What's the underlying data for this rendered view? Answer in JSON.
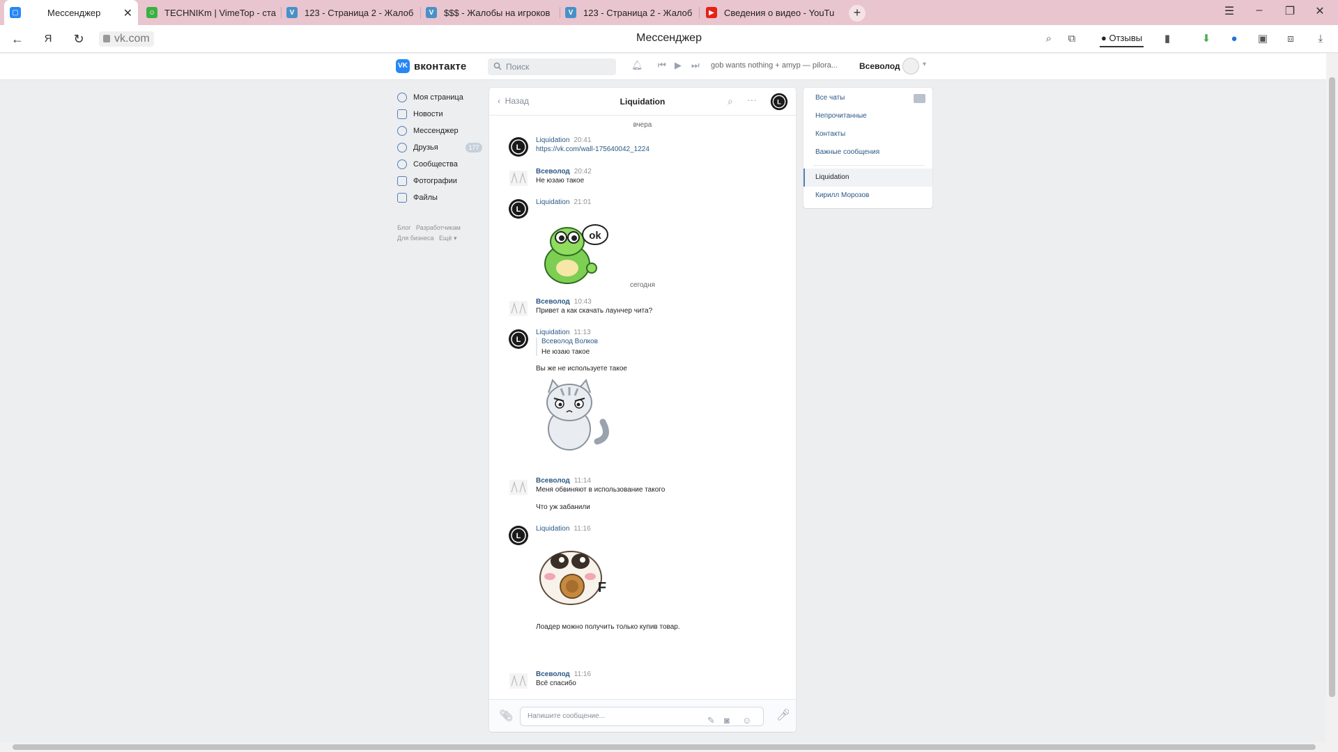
{
  "browser": {
    "tabs": [
      {
        "title": "Мессенджер",
        "active": true,
        "icon": "vk-messenger-icon"
      },
      {
        "title": "TECHNIKm | VimeTop - ста",
        "active": false,
        "icon": "vimetop-icon"
      },
      {
        "title": "123 - Страница 2 - Жалоб",
        "active": false,
        "icon": "forum-icon"
      },
      {
        "title": "$$$ - Жалобы на игроков",
        "active": false,
        "icon": "forum-icon"
      },
      {
        "title": "123 - Страница 2 - Жалоб",
        "active": false,
        "icon": "forum-icon"
      },
      {
        "title": "Сведения о видео - YouTu",
        "active": false,
        "icon": "youtube-icon"
      }
    ],
    "url": "vk.com",
    "page_title": "Мессенджер",
    "reviews_label": "Отзывы",
    "colors": {
      "tabbar": "#e9c5cf"
    }
  },
  "vk": {
    "logo_text": "вконтакте",
    "search_placeholder": "Поиск",
    "now_playing": "gob wants nothing + amyp — pilora...",
    "user_name": "Всеволод",
    "accent": "#2787f5",
    "menu": [
      {
        "label": "Моя страница",
        "icon": "user-icon"
      },
      {
        "label": "Новости",
        "icon": "news-icon"
      },
      {
        "label": "Мессенджер",
        "icon": "chat-icon"
      },
      {
        "label": "Друзья",
        "icon": "friends-icon",
        "badge": "177"
      },
      {
        "label": "Сообщества",
        "icon": "groups-icon"
      },
      {
        "label": "Фотографии",
        "icon": "photos-icon"
      },
      {
        "label": "Файлы",
        "icon": "files-icon"
      }
    ],
    "footer_links": [
      "Блог",
      "Разработчикам",
      "Для бизнеса",
      "Ещё"
    ]
  },
  "chat": {
    "back_label": "Назад",
    "title": "Liquidation",
    "date_yesterday": "вчера",
    "date_today": "сегодня",
    "messages": [
      {
        "author": "Liquidation",
        "time": "20:41",
        "text": "https://vk.com/wall-175640042_1224"
      },
      {
        "author": "Всеволод",
        "time": "20:42",
        "text": "Не юзаю такое"
      },
      {
        "author": "Liquidation",
        "time": "21:01",
        "sticker": "dino-ok-sticker"
      },
      {
        "author": "Всеволод",
        "time": "10:43",
        "text": "Привет а как скачать лаунчер чита?"
      },
      {
        "author": "Liquidation",
        "time": "11:13",
        "reply_author": "Всеволод Волков",
        "reply_text": "Не юзаю такое",
        "text": "Вы же не используете такое",
        "sticker": "grumpy-cat-sticker"
      },
      {
        "author": "Всеволод",
        "time": "11:14",
        "text": "Меня обвиняют в использование такого",
        "text2": "Что уж забанили"
      },
      {
        "author": "Liquidation",
        "time": "11:16",
        "sticker": "seal-cookie-sticker",
        "text": "Лоадер можно получить только купив товар."
      },
      {
        "author": "Всеволод",
        "time": "11:16",
        "text": "Всё спасибо"
      }
    ],
    "input_placeholder": "Напишите сообщение..."
  },
  "filters": {
    "items": [
      "Все чаты",
      "Непрочитанные",
      "Контакты",
      "Важные сообщения"
    ],
    "conversations": [
      "Liquidation",
      "Кирилл Морозов"
    ]
  }
}
